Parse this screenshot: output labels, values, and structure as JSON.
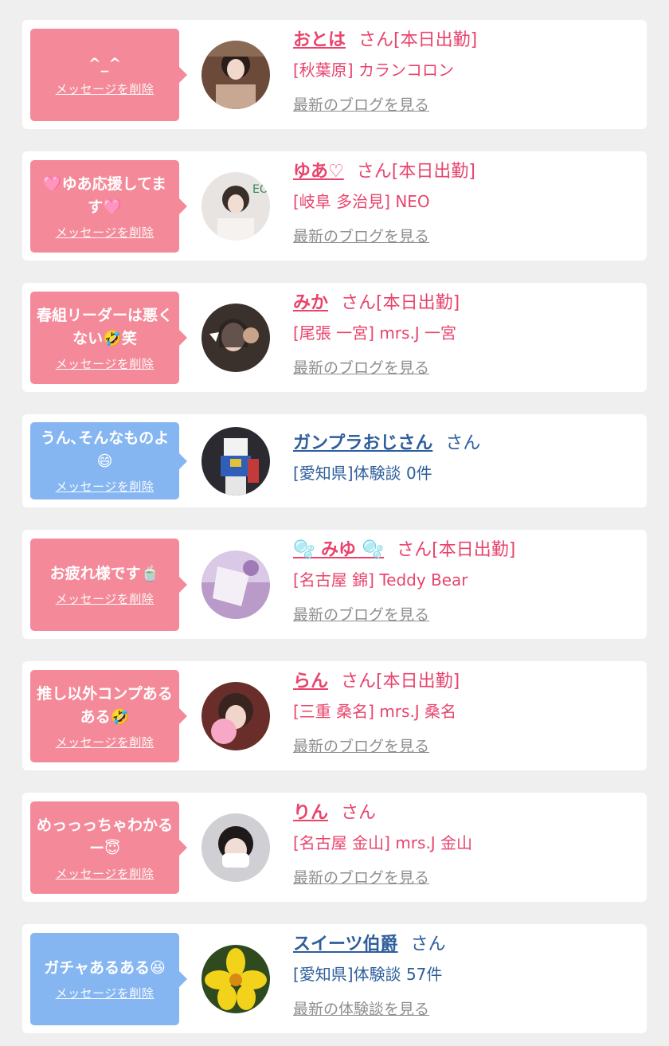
{
  "delete_label": "メッセージを削除",
  "colors": {
    "pink": "#f48a99",
    "blue": "#86b6f2",
    "pink_text": "#e8446c",
    "blue_text": "#2e5e9c"
  },
  "items": [
    {
      "bubble": "pink",
      "message": "^_^",
      "name": "おとは",
      "suffix": "さん[本日出勤]",
      "shop": "[秋葉原] カランコロン",
      "link": "最新のブログを見る",
      "name_color": "pink"
    },
    {
      "bubble": "pink",
      "message": "🩷ゆあ応援してます🩷",
      "name": "ゆあ♡",
      "suffix": "さん[本日出勤]",
      "shop": "[岐阜 多治見] NEO",
      "link": "最新のブログを見る",
      "name_color": "pink"
    },
    {
      "bubble": "pink",
      "message": "春組リーダーは悪くない🤣笑",
      "name": "みか",
      "suffix": "さん[本日出勤]",
      "shop": "[尾張 一宮] mrs.J 一宮",
      "link": "最新のブログを見る",
      "name_color": "pink"
    },
    {
      "bubble": "blue",
      "message": "うん､そんなものよ😄",
      "name": "ガンプラおじさん",
      "suffix": "さん",
      "shop": "[愛知県]体験談 0件",
      "link": "",
      "name_color": "blue"
    },
    {
      "bubble": "pink",
      "message": "お疲れ様です🍵",
      "name": "🫧 みゆ 🫧",
      "suffix": "さん[本日出勤]",
      "shop": "[名古屋 錦] Teddy Bear",
      "link": "最新のブログを見る",
      "name_color": "pink"
    },
    {
      "bubble": "pink",
      "message": "推し以外コンプあるある🤣",
      "name": "らん",
      "suffix": "さん[本日出勤]",
      "shop": "[三重 桑名] mrs.J 桑名",
      "link": "最新のブログを見る",
      "name_color": "pink"
    },
    {
      "bubble": "pink",
      "message": "めっっっちゃわかるー😇",
      "name": "りん",
      "suffix": "さん",
      "shop": "[名古屋 金山] mrs.J 金山",
      "link": "最新のブログを見る",
      "name_color": "pink"
    },
    {
      "bubble": "blue",
      "message": "ガチャあるある😆",
      "name": "スイーツ伯爵",
      "suffix": "さん",
      "shop": "[愛知県]体験談 57件",
      "link": "最新の体験談を見る",
      "name_color": "blue"
    }
  ]
}
